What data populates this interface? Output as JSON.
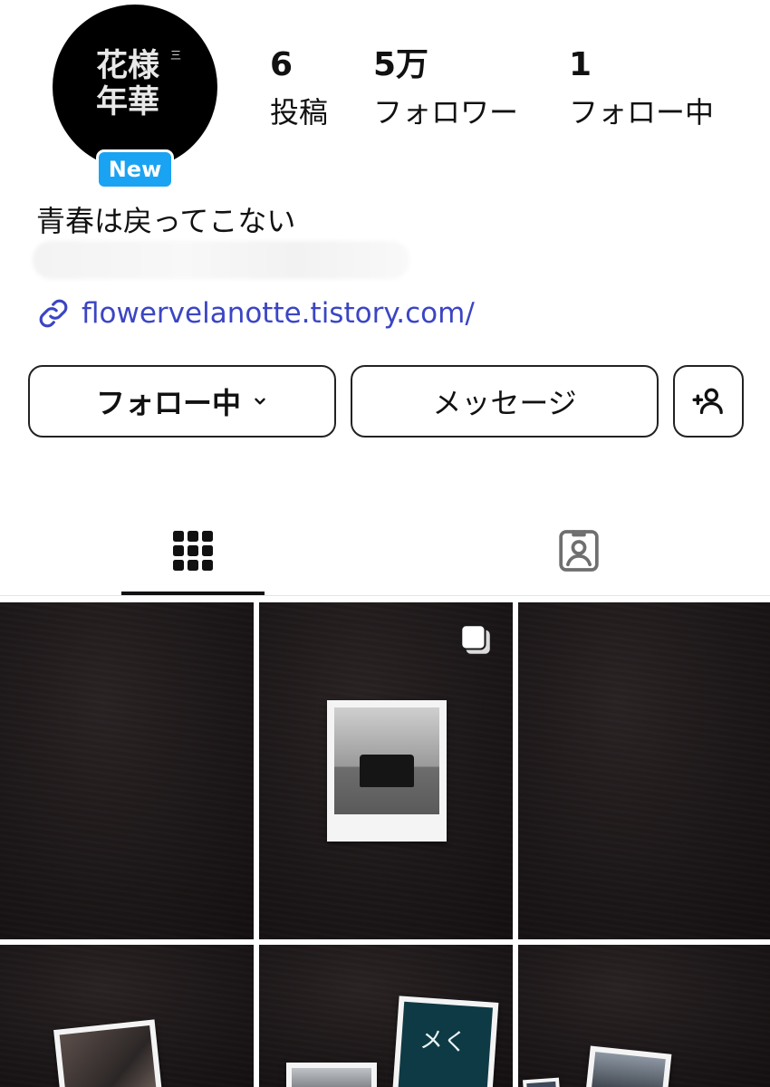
{
  "profile": {
    "avatar_logo_line1": "花様",
    "avatar_logo_line2": "年華",
    "avatar_mark": "三",
    "new_badge": "New",
    "accent_color": "#1aa3f2"
  },
  "stats": [
    {
      "num": "6",
      "label": "投稿"
    },
    {
      "num": "5万",
      "label": "フォロワー"
    },
    {
      "num": "1",
      "label": "フォロー中"
    }
  ],
  "bio": {
    "name_line": "青春は戻ってこない",
    "link": "flowervelanotte.tistory.com/",
    "link_color": "#3b45c4"
  },
  "actions": {
    "follow_label": "フォロー中",
    "message_label": "メッセージ",
    "add_person_icon": "add-person-icon"
  },
  "tabs": [
    {
      "icon": "grid-icon",
      "selected": true
    },
    {
      "icon": "tagged-person-icon",
      "selected": false
    }
  ],
  "grid": {
    "posts_visible": 6,
    "multi_photo_icon": "carousel-icon",
    "card_text": "メく"
  }
}
